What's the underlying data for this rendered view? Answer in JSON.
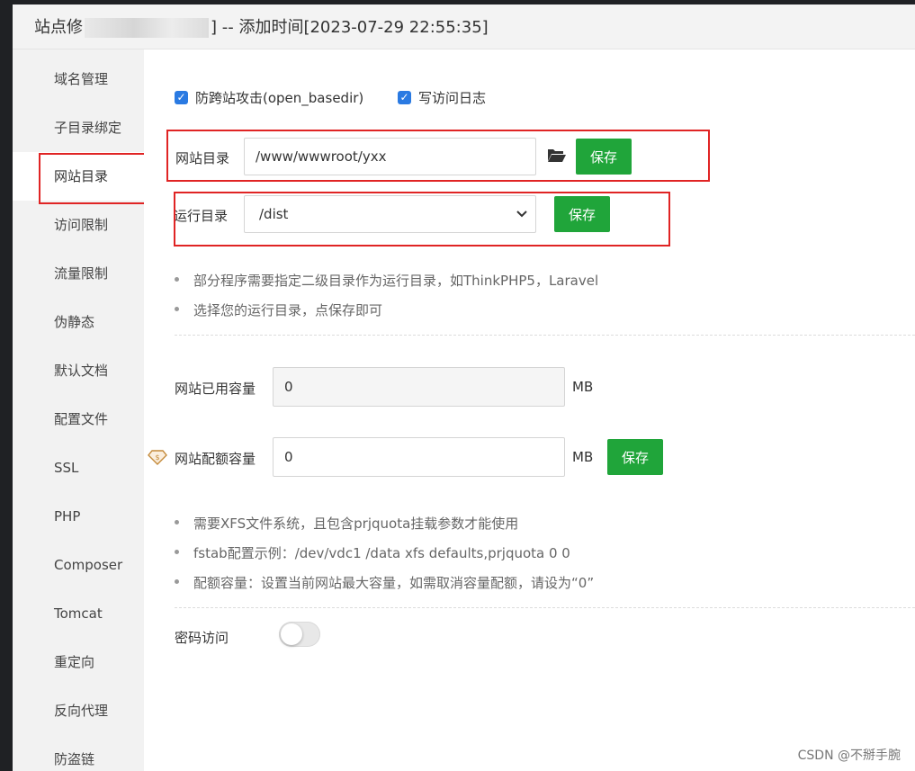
{
  "window": {
    "title_prefix": "站点修",
    "title_suffix": "] -- 添加时间[2023-07-29 22:55:35]"
  },
  "sidebar": {
    "items": [
      {
        "label": "域名管理"
      },
      {
        "label": "子目录绑定"
      },
      {
        "label": "网站目录",
        "active": true
      },
      {
        "label": "访问限制"
      },
      {
        "label": "流量限制"
      },
      {
        "label": "伪静态"
      },
      {
        "label": "默认文档"
      },
      {
        "label": "配置文件"
      },
      {
        "label": "SSL"
      },
      {
        "label": "PHP"
      },
      {
        "label": "Composer"
      },
      {
        "label": "Tomcat"
      },
      {
        "label": "重定向"
      },
      {
        "label": "反向代理"
      },
      {
        "label": "防盗链"
      }
    ]
  },
  "options": {
    "anti_xss_label": "防跨站攻击(open_basedir)",
    "anti_xss_checked": true,
    "access_log_label": "写访问日志",
    "access_log_checked": true
  },
  "site_dir": {
    "label": "网站目录",
    "value": "/www/wwwroot/yxx",
    "folder_icon": "folder-open-icon",
    "save_label": "保存"
  },
  "run_dir": {
    "label": "运行目录",
    "value": "/dist",
    "save_label": "保存"
  },
  "run_dir_tips": [
    "部分程序需要指定二级目录作为运行目录，如ThinkPHP5，Laravel",
    "选择您的运行目录，点保存即可"
  ],
  "quota": {
    "used_label": "网站已用容量",
    "used_value": "0",
    "used_unit": "MB",
    "limit_label": "网站配额容量",
    "limit_value": "0",
    "limit_unit": "MB",
    "save_label": "保存",
    "badge_icon": "vip-diamond-icon"
  },
  "quota_tips": [
    "需要XFS文件系统，且包含prjquota挂载参数才能使用",
    "fstab配置示例：/dev/vdc1 /data xfs defaults,prjquota 0 0",
    "配额容量：设置当前网站最大容量，如需取消容量配额，请设为“0”"
  ],
  "password_access": {
    "label": "密码访问",
    "enabled": false
  },
  "watermark": "CSDN @不掰手腕",
  "colors": {
    "accent_green": "#20a53a",
    "checkbox_blue": "#2a7ae2",
    "highlight_red": "#e02424"
  }
}
